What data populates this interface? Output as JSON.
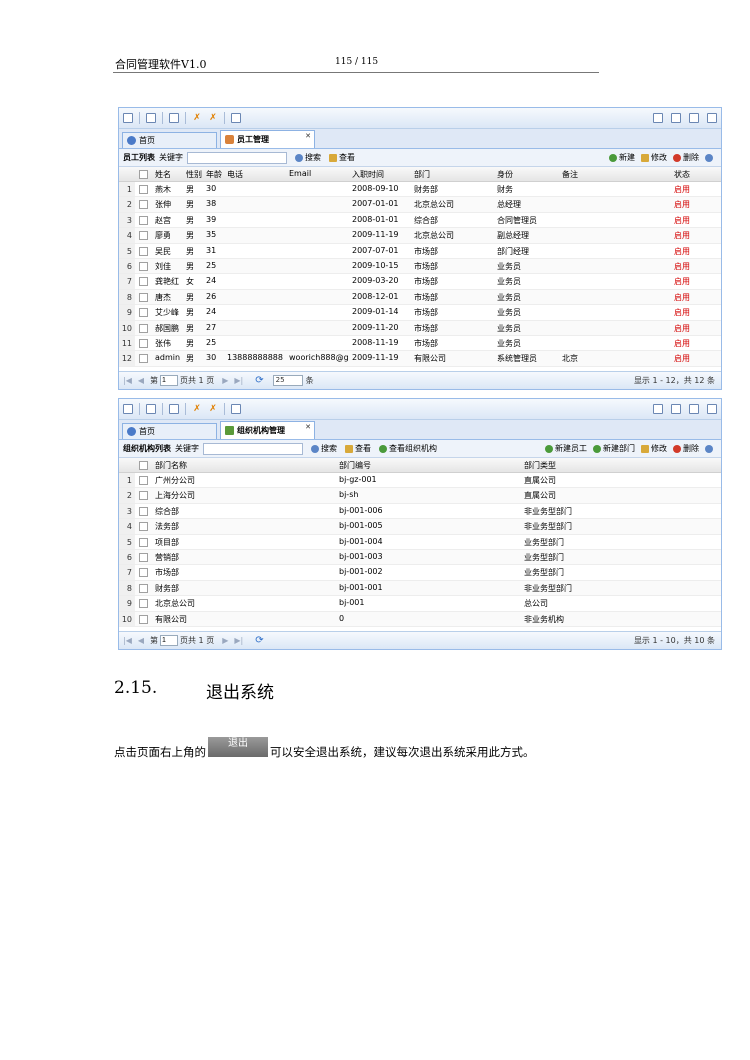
{
  "header": {
    "title": "合同管理软件V1.0",
    "page": "115 / 115"
  },
  "employee_panel": {
    "tabs": [
      "首页",
      "员工管理"
    ],
    "search": {
      "title": "员工列表",
      "keyword_label": "关键字",
      "search_btn": "搜索",
      "view_btn": "查看"
    },
    "actions": [
      "新建",
      "修改",
      "删除"
    ],
    "columns": [
      "姓名",
      "性别",
      "年龄",
      "电话",
      "Email",
      "入职时间",
      "部门",
      "身份",
      "备注",
      "状态"
    ],
    "rows": [
      [
        "1",
        "燕木",
        "男",
        "30",
        "",
        "",
        "2008-09-10",
        "财务部",
        "财务",
        "",
        "启用"
      ],
      [
        "2",
        "张伸",
        "男",
        "38",
        "",
        "",
        "2007-01-01",
        "北京总公司",
        "总经理",
        "",
        "启用"
      ],
      [
        "3",
        "赵宫",
        "男",
        "39",
        "",
        "",
        "2008-01-01",
        "综合部",
        "合同管理员",
        "",
        "启用"
      ],
      [
        "4",
        "廖勇",
        "男",
        "35",
        "",
        "",
        "2009-11-19",
        "北京总公司",
        "副总经理",
        "",
        "启用"
      ],
      [
        "5",
        "吴民",
        "男",
        "31",
        "",
        "",
        "2007-07-01",
        "市场部",
        "部门经理",
        "",
        "启用"
      ],
      [
        "6",
        "刘佳",
        "男",
        "25",
        "",
        "",
        "2009-10-15",
        "市场部",
        "业务员",
        "",
        "启用"
      ],
      [
        "7",
        "龚艳红",
        "女",
        "24",
        "",
        "",
        "2009-03-20",
        "市场部",
        "业务员",
        "",
        "启用"
      ],
      [
        "8",
        "唐杰",
        "男",
        "26",
        "",
        "",
        "2008-12-01",
        "市场部",
        "业务员",
        "",
        "启用"
      ],
      [
        "9",
        "艾少峰",
        "男",
        "24",
        "",
        "",
        "2009-01-14",
        "市场部",
        "业务员",
        "",
        "启用"
      ],
      [
        "10",
        "郝国鹏",
        "男",
        "27",
        "",
        "",
        "2009-11-20",
        "市场部",
        "业务员",
        "",
        "启用"
      ],
      [
        "11",
        "张伟",
        "男",
        "25",
        "",
        "",
        "2008-11-19",
        "市场部",
        "业务员",
        "",
        "启用"
      ],
      [
        "12",
        "admin",
        "男",
        "30",
        "13888888888",
        "woorich888@g",
        "2009-11-19",
        "有限公司",
        "系统管理员",
        "北京",
        "启用"
      ]
    ],
    "pager": {
      "page_label": "第",
      "page": "1",
      "total": "页共 1 页",
      "size": "25",
      "size_unit": "条",
      "info": "显示 1 - 12，共 12 条"
    }
  },
  "org_panel": {
    "tabs": [
      "首页",
      "组织机构管理"
    ],
    "search": {
      "title": "组织机构列表",
      "keyword_label": "关键字",
      "search_btn": "搜索",
      "view_btn": "查看",
      "view_org_btn": "查看组织机构"
    },
    "actions": [
      "新建员工",
      "新建部门",
      "修改",
      "删除"
    ],
    "columns": [
      "部门名称",
      "部门编号",
      "部门类型"
    ],
    "rows": [
      [
        "1",
        "广州分公司",
        "bj-gz-001",
        "直属公司"
      ],
      [
        "2",
        "上海分公司",
        "bj-sh",
        "直属公司"
      ],
      [
        "3",
        "综合部",
        "bj-001-006",
        "非业务型部门"
      ],
      [
        "4",
        "法务部",
        "bj-001-005",
        "非业务型部门"
      ],
      [
        "5",
        "项目部",
        "bj-001-004",
        "业务型部门"
      ],
      [
        "6",
        "营销部",
        "bj-001-003",
        "业务型部门"
      ],
      [
        "7",
        "市场部",
        "bj-001-002",
        "业务型部门"
      ],
      [
        "8",
        "财务部",
        "bj-001-001",
        "非业务型部门"
      ],
      [
        "9",
        "北京总公司",
        "bj-001",
        "总公司"
      ],
      [
        "10",
        "有限公司",
        "0",
        "非业务机构"
      ]
    ],
    "pager": {
      "page_label": "第",
      "page": "1",
      "total": "页共 1 页",
      "info": "显示 1 - 10，共 10 条"
    }
  },
  "section": {
    "number": "2.15.",
    "title": "退出系统"
  },
  "paragraph": {
    "before": "点击页面右上角的",
    "button": "退出",
    "after": "可以安全退出系统，建议每次退出系统采用此方式。"
  }
}
